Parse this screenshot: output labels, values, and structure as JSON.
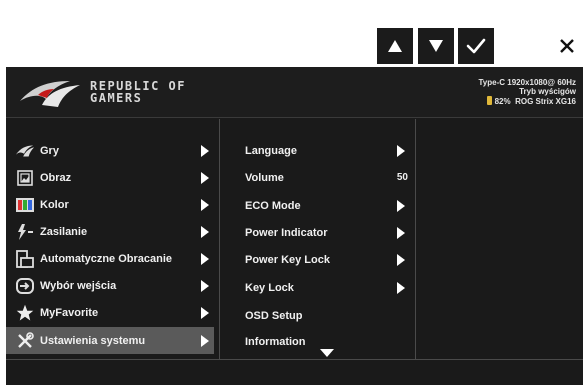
{
  "controls": {
    "up_icon": "triangle-up",
    "down_icon": "triangle-down",
    "confirm_icon": "checkmark",
    "close_icon": "x-mark"
  },
  "header": {
    "brand_line1": "REPUBLIC OF",
    "brand_line2": "GAMERS",
    "status_line1": "Type-C  1920x1080@  60Hz",
    "status_line2": "Tryb wyścigów",
    "battery_percent": "82%",
    "model": "ROG Strix XG16",
    "battery_color": "#e0b83a"
  },
  "menu": {
    "items": [
      {
        "label": "Gry",
        "icon": "gamepad-icon"
      },
      {
        "label": "Obraz",
        "icon": "picture-icon"
      },
      {
        "label": "Kolor",
        "icon": "color-icon"
      },
      {
        "label": "Zasilanie",
        "icon": "power-icon"
      },
      {
        "label": "Automatyczne Obracanie",
        "icon": "rotate-icon"
      },
      {
        "label": "Wybór wejścia",
        "icon": "input-icon"
      },
      {
        "label": "MyFavorite",
        "icon": "star-icon"
      },
      {
        "label": "Ustawienia systemu",
        "icon": "tools-icon"
      }
    ],
    "selected_index": 7
  },
  "submenu": {
    "items": [
      {
        "label": "Language",
        "value": null
      },
      {
        "label": "Volume",
        "value": "50"
      },
      {
        "label": "ECO Mode",
        "value": null
      },
      {
        "label": "Power Indicator",
        "value": null
      },
      {
        "label": "Power Key Lock",
        "value": null
      },
      {
        "label": "Key Lock",
        "value": null
      },
      {
        "label": "OSD Setup",
        "value": null
      },
      {
        "label": "Information",
        "value": null
      }
    ]
  },
  "colors": {
    "osd_bg": "#1a1a1a",
    "selected_bg": "#5a5a5a",
    "text": "#f0f0f0"
  }
}
